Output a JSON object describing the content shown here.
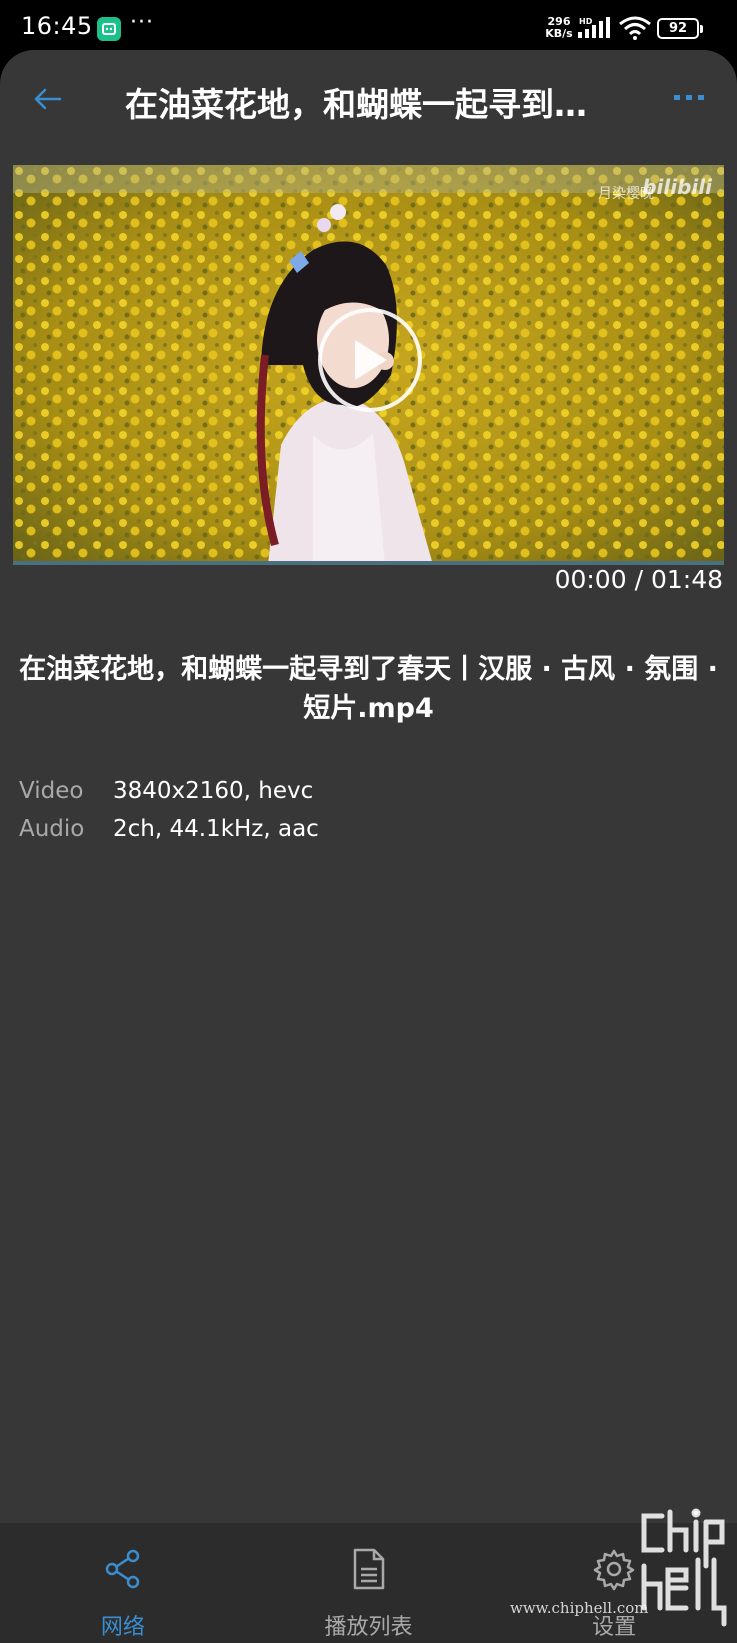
{
  "status_bar": {
    "time": "16:45",
    "dots": "···",
    "net_speed_value": "296",
    "net_speed_unit": "KB/s",
    "signal_tag": "HD",
    "battery": "92",
    "icons": [
      "mi-home-icon",
      "signal-icon",
      "wifi-icon",
      "battery-icon"
    ]
  },
  "header": {
    "title": "在油菜花地，和蝴蝶一起寻到…",
    "back_icon": "back-arrow-icon",
    "more_icon": "more-dots-icon"
  },
  "player": {
    "watermark_text": "月染樱晚",
    "watermark_logo": "bilibili",
    "current_time": "00:00",
    "duration": "01:48",
    "time_separator": "/",
    "progress": 0.0,
    "accent_color": "#3a8ed0"
  },
  "file": {
    "title": "在油菜花地，和蝴蝶一起寻到了春天丨汉服 · 古风 · 氛围 · 短片.mp4",
    "meta": [
      {
        "key": "Video",
        "value": "3840x2160, hevc"
      },
      {
        "key": "Audio",
        "value": "2ch, 44.1kHz, aac"
      }
    ]
  },
  "bottom_nav": {
    "items": [
      {
        "label": "网络",
        "icon": "share-network-icon",
        "active": true
      },
      {
        "label": "播放列表",
        "icon": "playlist-document-icon",
        "active": false
      },
      {
        "label": "设置",
        "icon": "gear-icon",
        "active": false
      }
    ]
  },
  "watermark": {
    "site": "www.chiphell.com",
    "logo": "chip hell"
  }
}
